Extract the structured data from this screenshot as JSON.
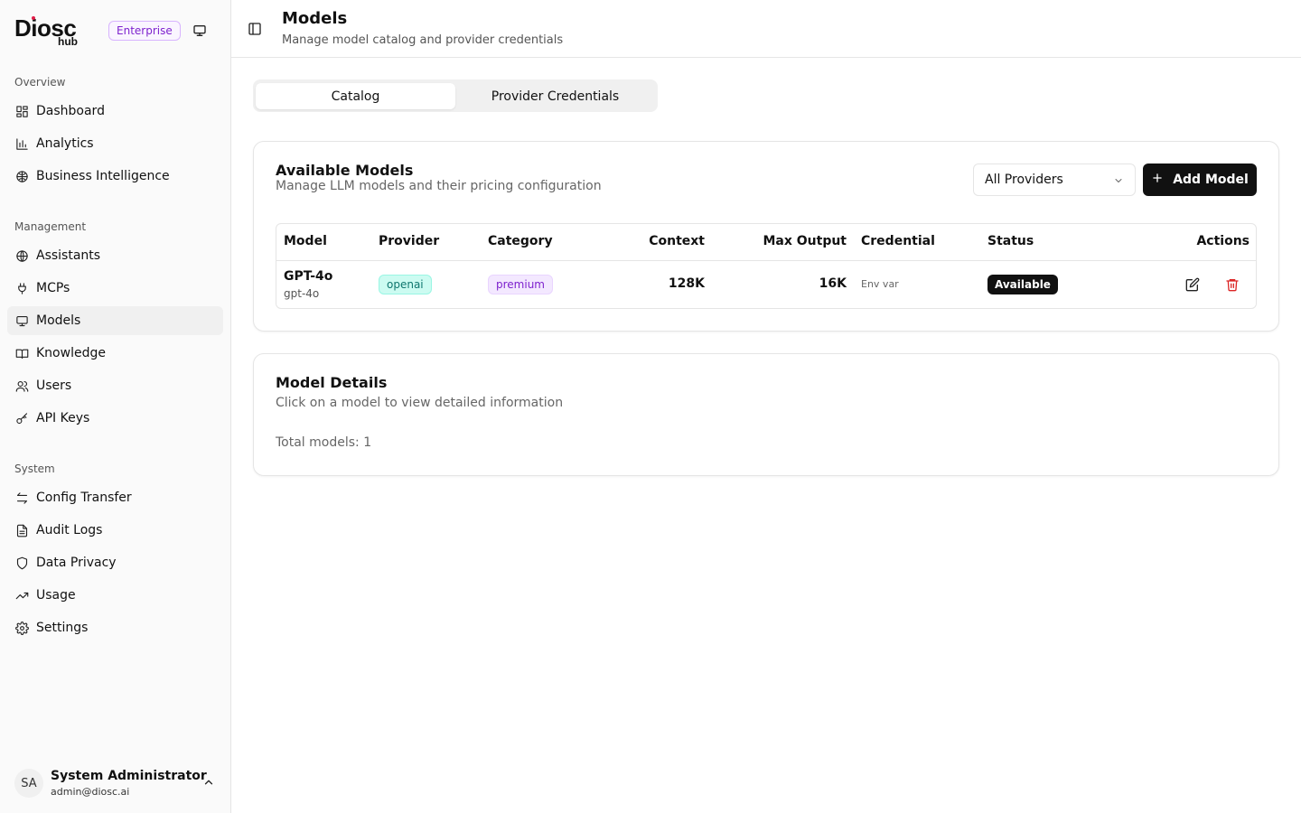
{
  "brand": {
    "name": "Diosc",
    "sub": "hub",
    "badge": "Enterprise"
  },
  "sidebar": {
    "sections": [
      {
        "label": "Overview"
      },
      {
        "label": "Management"
      },
      {
        "label": "System"
      }
    ],
    "items": [
      {
        "label": "Dashboard",
        "icon": "dashboard-icon"
      },
      {
        "label": "Analytics",
        "icon": "bar-chart-icon"
      },
      {
        "label": "Business Intelligence",
        "icon": "brain-icon"
      },
      {
        "label": "Assistants",
        "icon": "globe-icon"
      },
      {
        "label": "MCPs",
        "icon": "plug-icon"
      },
      {
        "label": "Models",
        "icon": "monitor-icon"
      },
      {
        "label": "Knowledge",
        "icon": "book-icon"
      },
      {
        "label": "Users",
        "icon": "users-icon"
      },
      {
        "label": "API Keys",
        "icon": "key-icon"
      },
      {
        "label": "Config Transfer",
        "icon": "arrows-swap-icon"
      },
      {
        "label": "Audit Logs",
        "icon": "file-text-icon"
      },
      {
        "label": "Data Privacy",
        "icon": "shield-icon"
      },
      {
        "label": "Usage",
        "icon": "trending-up-icon"
      },
      {
        "label": "Settings",
        "icon": "gear-icon"
      }
    ]
  },
  "user": {
    "initials": "SA",
    "name": "System Administrator",
    "email": "admin@diosc.ai"
  },
  "header": {
    "title": "Models",
    "subtitle": "Manage model catalog and provider credentials"
  },
  "tabs": [
    {
      "label": "Catalog"
    },
    {
      "label": "Provider Credentials"
    }
  ],
  "models_card": {
    "title": "Available Models",
    "description": "Manage LLM models and their pricing configuration",
    "provider_filter": "All Providers",
    "add_label": "Add Model",
    "columns": [
      "Model",
      "Provider",
      "Category",
      "Context",
      "Max Output",
      "Credential",
      "Status",
      "Actions"
    ],
    "rows": [
      {
        "name": "GPT-4o",
        "id": "gpt-4o",
        "provider": "openai",
        "category": "premium",
        "context": "128K",
        "max_output": "16K",
        "credential": "Env var",
        "status": "Available"
      }
    ]
  },
  "details_card": {
    "title": "Model Details",
    "description": "Click on a model to view detailed information",
    "total": "Total models: 1"
  },
  "colors": {
    "accent": "#111111",
    "danger": "#dc2626",
    "enterprise": "#7e22ce"
  }
}
